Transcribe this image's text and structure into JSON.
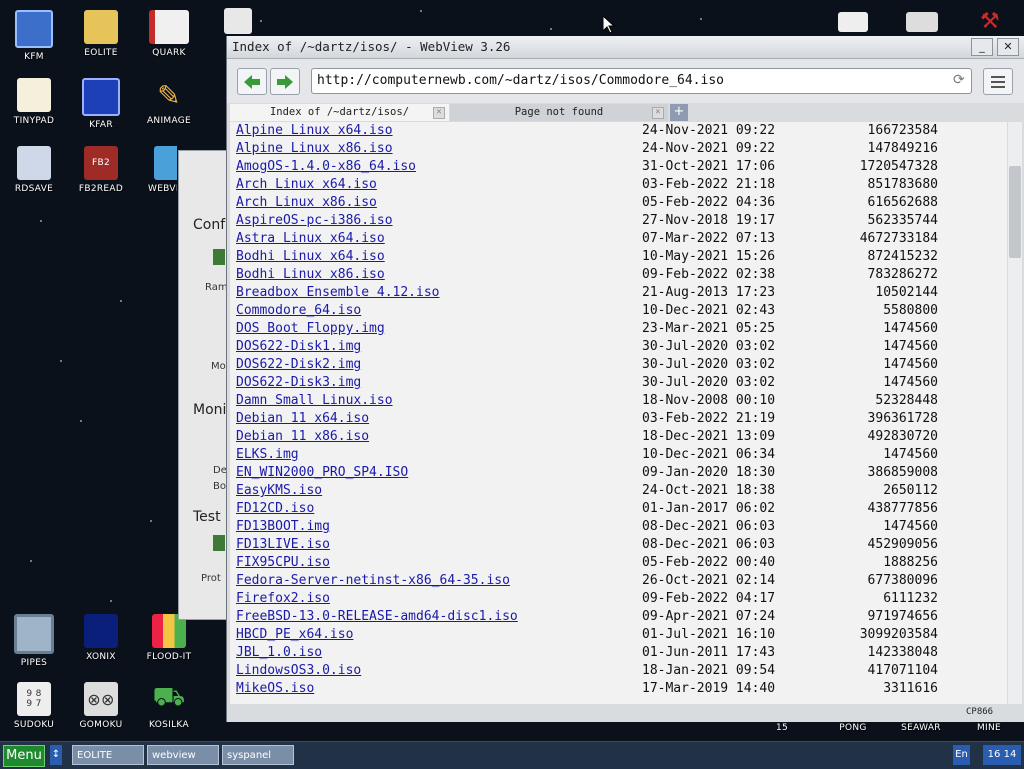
{
  "desktop": {
    "icons": [
      {
        "label": "KFM"
      },
      {
        "label": "EOLITE"
      },
      {
        "label": "QUARK"
      },
      {
        "label": "TINYPAD"
      },
      {
        "label": "KFAR"
      },
      {
        "label": "ANIMAGE"
      },
      {
        "label": "RDSAVE"
      },
      {
        "label": "FB2READ"
      },
      {
        "label": "WEBVIEW"
      },
      {
        "label": "PIPES"
      },
      {
        "label": "XONIX"
      },
      {
        "label": "FLOOD-IT"
      },
      {
        "label": "SUDOKU"
      },
      {
        "label": "GOMOKU"
      },
      {
        "label": "KOSILKA"
      },
      {
        "label": "15"
      },
      {
        "label": "PONG"
      },
      {
        "label": "SEAWAR"
      },
      {
        "label": "MINE"
      },
      {
        "label": "CP866"
      }
    ]
  },
  "bgwindow": {
    "lines": [
      "Conf",
      "Ram",
      "Mo",
      "Moni",
      "De",
      "Bo",
      "Test",
      "Prot"
    ]
  },
  "window": {
    "title": "Index of /~dartz/isos/ - WebView 3.26",
    "minimize": "_",
    "close": "✕"
  },
  "toolbar": {
    "url": "http://computernewb.com/~dartz/isos/Commodore_64.iso",
    "reload": "⟳"
  },
  "tabs": [
    {
      "label": "Index of /~dartz/isos/"
    },
    {
      "label": "Page not found"
    }
  ],
  "newtab": "+",
  "files": [
    {
      "name": "Alpine Linux x64.iso",
      "date": "24-Nov-2021 09:22",
      "size": "166723584"
    },
    {
      "name": "Alpine Linux x86.iso",
      "date": "24-Nov-2021 09:22",
      "size": "147849216"
    },
    {
      "name": "AmogOS-1.4.0-x86_64.iso",
      "date": "31-Oct-2021 17:06",
      "size": "1720547328"
    },
    {
      "name": "Arch Linux x64.iso",
      "date": "03-Feb-2022 21:18",
      "size": "851783680"
    },
    {
      "name": "Arch Linux x86.iso",
      "date": "05-Feb-2022 04:36",
      "size": "616562688"
    },
    {
      "name": "AspireOS-pc-i386.iso",
      "date": "27-Nov-2018 19:17",
      "size": "562335744"
    },
    {
      "name": "Astra Linux x64.iso",
      "date": "07-Mar-2022 07:13",
      "size": "4672733184"
    },
    {
      "name": "Bodhi Linux x64.iso",
      "date": "10-May-2021 15:26",
      "size": "872415232"
    },
    {
      "name": "Bodhi Linux x86.iso",
      "date": "09-Feb-2022 02:38",
      "size": "783286272"
    },
    {
      "name": "Breadbox Ensemble 4.12.iso",
      "date": "21-Aug-2013 17:23",
      "size": "10502144"
    },
    {
      "name": "Commodore_64.iso",
      "date": "10-Dec-2021 02:43",
      "size": "5580800"
    },
    {
      "name": "DOS Boot Floppy.img",
      "date": "23-Mar-2021 05:25",
      "size": "1474560"
    },
    {
      "name": "DOS622-Disk1.img",
      "date": "30-Jul-2020 03:02",
      "size": "1474560"
    },
    {
      "name": "DOS622-Disk2.img",
      "date": "30-Jul-2020 03:02",
      "size": "1474560"
    },
    {
      "name": "DOS622-Disk3.img",
      "date": "30-Jul-2020 03:02",
      "size": "1474560"
    },
    {
      "name": "Damn Small Linux.iso",
      "date": "18-Nov-2008 00:10",
      "size": "52328448"
    },
    {
      "name": "Debian 11 x64.iso",
      "date": "03-Feb-2022 21:19",
      "size": "396361728"
    },
    {
      "name": "Debian 11 x86.iso",
      "date": "18-Dec-2021 13:09",
      "size": "492830720"
    },
    {
      "name": "ELKS.img",
      "date": "10-Dec-2021 06:34",
      "size": "1474560"
    },
    {
      "name": "EN_WIN2000_PRO_SP4.ISO",
      "date": "09-Jan-2020 18:30",
      "size": "386859008"
    },
    {
      "name": "EasyKMS.iso",
      "date": "24-Oct-2021 18:38",
      "size": "2650112"
    },
    {
      "name": "FD12CD.iso",
      "date": "01-Jan-2017 06:02",
      "size": "438777856"
    },
    {
      "name": "FD13BOOT.img",
      "date": "08-Dec-2021 06:03",
      "size": "1474560"
    },
    {
      "name": "FD13LIVE.iso",
      "date": "08-Dec-2021 06:03",
      "size": "452909056"
    },
    {
      "name": "FIX95CPU.iso",
      "date": "05-Feb-2022 00:40",
      "size": "1888256"
    },
    {
      "name": "Fedora-Server-netinst-x86_64-35.iso",
      "date": "26-Oct-2021 02:14",
      "size": "677380096"
    },
    {
      "name": "Firefox2.iso",
      "date": "09-Feb-2022 04:17",
      "size": "6111232"
    },
    {
      "name": "FreeBSD-13.0-RELEASE-amd64-disc1.iso",
      "date": "09-Apr-2021 07:24",
      "size": "971974656"
    },
    {
      "name": "HBCD_PE_x64.iso",
      "date": "01-Jul-2021 16:10",
      "size": "3099203584"
    },
    {
      "name": "JBL_1.0.iso",
      "date": "01-Jun-2011 17:43",
      "size": "142338048"
    },
    {
      "name": "LindowsOS3.0.iso",
      "date": "18-Jan-2021 09:54",
      "size": "417071104"
    },
    {
      "name": "MikeOS.iso",
      "date": "17-Mar-2019 14:40",
      "size": "3311616"
    }
  ],
  "taskbar": {
    "start": "Menu",
    "switcher": "↕",
    "tasks": [
      {
        "label": "EOLITE"
      },
      {
        "label": "webview"
      },
      {
        "label": "syspanel"
      }
    ],
    "lang": "En",
    "clock": "16 14"
  },
  "colors": {
    "link": "#1a1aa8",
    "start": "#1f8a2d",
    "taskbar": "#213146"
  }
}
